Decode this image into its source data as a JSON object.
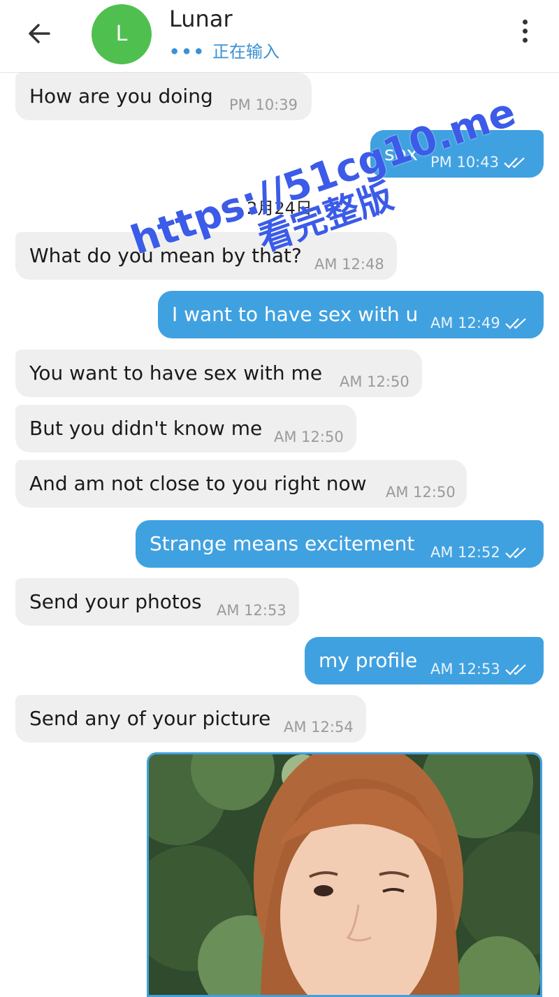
{
  "header": {
    "contact_name": "Lunar",
    "avatar_letter": "L",
    "avatar_color": "#4fc04f",
    "typing_dots": "•••",
    "typing_status": "正在输入"
  },
  "date_separator": "2月24日",
  "messages": [
    {
      "side": "in",
      "text": "How are you doing",
      "time": "PM 10:39"
    },
    {
      "side": "out",
      "text": "sex",
      "time": "PM 10:43",
      "read": true
    },
    {
      "side": "in",
      "text": "What do you mean by that?",
      "time": "AM 12:48"
    },
    {
      "side": "out",
      "text": "I want to have sex with u",
      "time": "AM 12:49",
      "read": true
    },
    {
      "side": "in",
      "text": "You want to have sex with me",
      "time": "AM 12:50"
    },
    {
      "side": "in",
      "text": "But you didn't know me",
      "time": "AM 12:50"
    },
    {
      "side": "in",
      "text": "And am not close to you right now",
      "time": "AM 12:50"
    },
    {
      "side": "out",
      "text": "Strange means excitement",
      "time": "AM 12:52",
      "read": true
    },
    {
      "side": "in",
      "text": "Send your photos",
      "time": "AM 12:53"
    },
    {
      "side": "out",
      "text": "my profile",
      "time": "AM 12:53",
      "read": true
    },
    {
      "side": "in",
      "text": "Send any of your picture",
      "time": "AM 12:54"
    }
  ],
  "watermark": {
    "line1": "https://51cg10.me",
    "line2": "看完整版"
  },
  "colors": {
    "accent": "#40a1e0",
    "incoming_bubble": "#efefef",
    "watermark": "#3b5be8"
  }
}
